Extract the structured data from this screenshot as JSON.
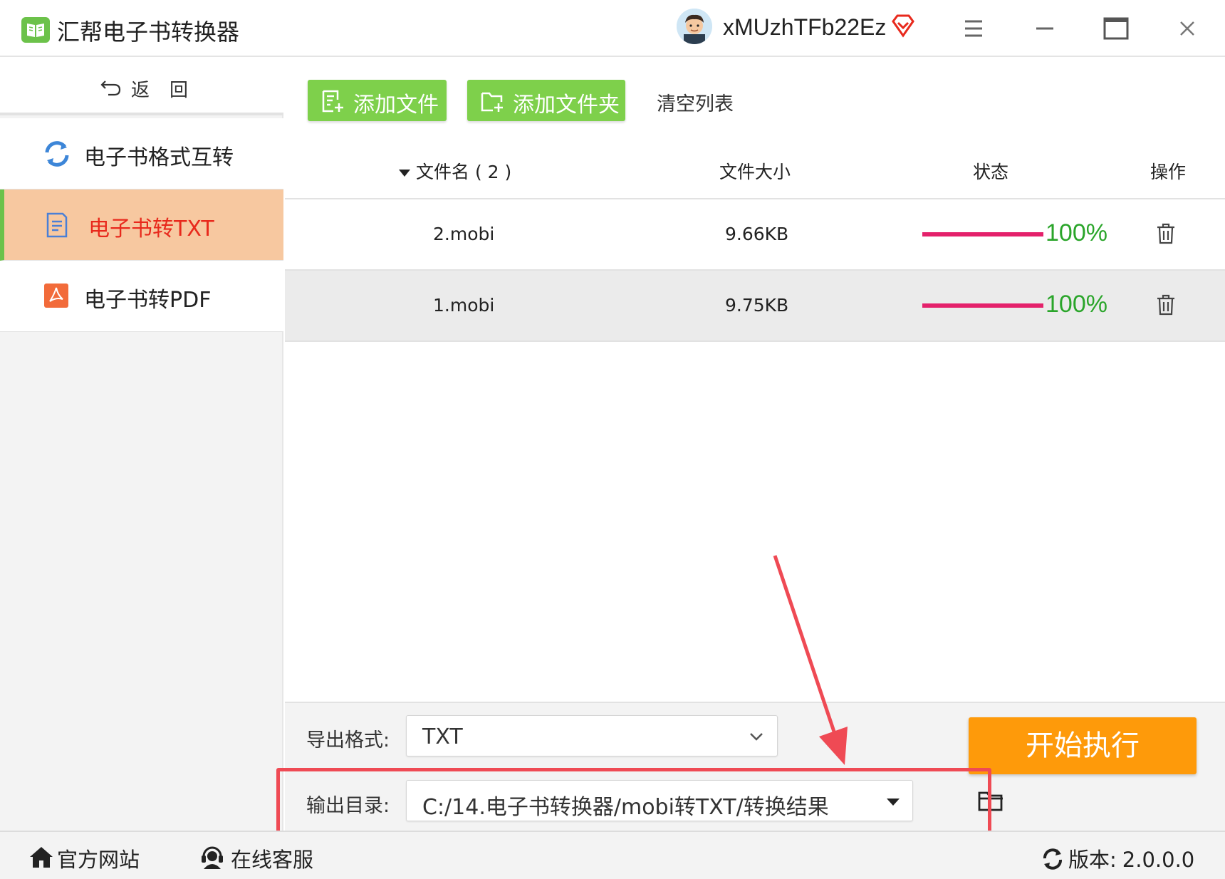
{
  "app": {
    "title": "汇帮电子书转换器",
    "username": "xMUzhTFb22Ez",
    "brand_color": "#6cc24a"
  },
  "sidebar": {
    "back_label": "返回",
    "items": [
      {
        "label": "电子书格式互转",
        "icon": "refresh-icon",
        "active": false
      },
      {
        "label": "电子书转TXT",
        "icon": "document-icon",
        "active": true
      },
      {
        "label": "电子书转PDF",
        "icon": "pdf-icon",
        "active": false
      }
    ]
  },
  "toolbar": {
    "add_file_label": "添加文件",
    "add_folder_label": "添加文件夹",
    "clear_label": "清空列表"
  },
  "table": {
    "columns": {
      "name": "文件名 ( 2 )",
      "size": "文件大小",
      "status": "状态",
      "action": "操作"
    },
    "rows": [
      {
        "name": "2.mobi",
        "size": "9.66KB",
        "progress": "100%"
      },
      {
        "name": "1.mobi",
        "size": "9.75KB",
        "progress": "100%"
      }
    ],
    "progress_color": "#e4216b",
    "percent_color": "#2aa52a"
  },
  "settings": {
    "format_label": "导出格式:",
    "format_value": "TXT",
    "output_label": "输出目录:",
    "output_value": "C:/14.电子书转换器/mobi转TXT/转换结果",
    "start_label": "开始执行",
    "start_color": "#fe9a0a"
  },
  "footer": {
    "website_label": "官方网站",
    "support_label": "在线客服",
    "version_label": "版本:",
    "version_value": "2.0.0.0"
  },
  "annotation_color": "#ef4a54"
}
